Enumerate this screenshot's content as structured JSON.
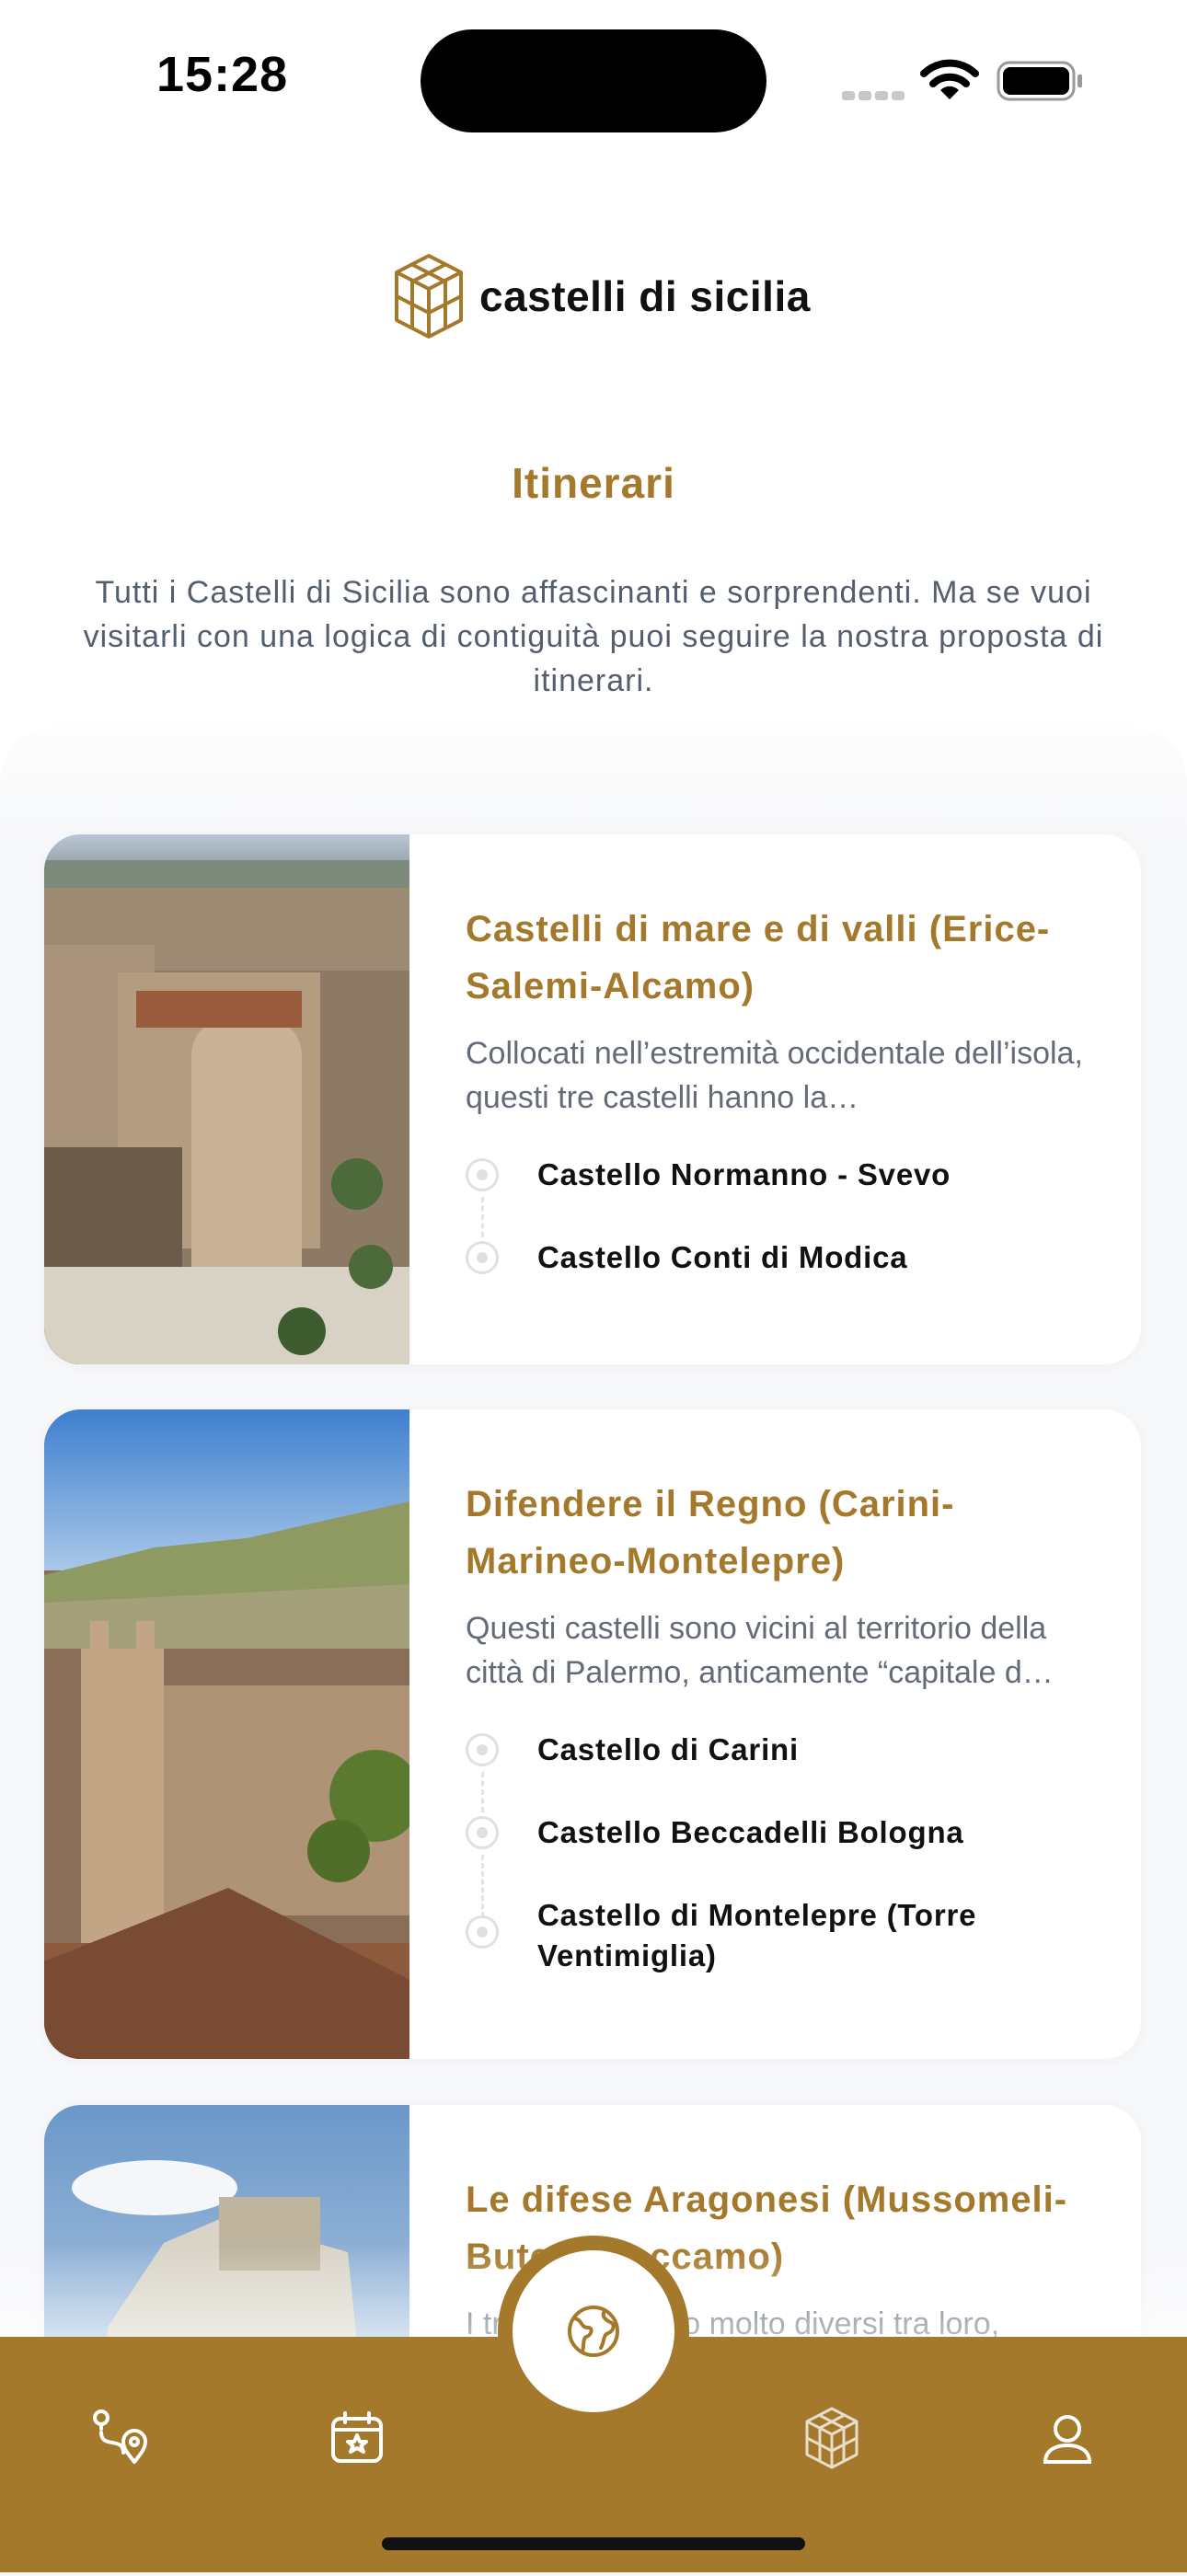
{
  "status_bar": {
    "time": "15:28"
  },
  "brand": {
    "name": "castelli di sicilia",
    "color": "#A5792B"
  },
  "page": {
    "title": "Itinerari",
    "intro": "Tutti i Castelli di Sicilia sono affascinanti e sorprendenti. Ma se vuoi visitarli con una logica di contiguità puoi seguire la nostra proposta di itinerari."
  },
  "itineraries": [
    {
      "title": "Castelli di mare e di valli (Erice-Salemi-Alcamo)",
      "description": "Collocati nell’estremità occidentale dell’isola, questi tre castelli hanno la…",
      "stops": [
        "Castello Normanno - Svevo",
        "Castello Conti di Modica"
      ]
    },
    {
      "title": "Difendere il Regno (Carini-Marineo-Montelepre)",
      "description": "Questi castelli sono vicini al territorio della città di Palermo, anticamente “capitale d…",
      "stops": [
        "Castello di Carini",
        "Castello Beccadelli Bologna",
        "Castello di Montelepre (Torre Ventimiglia)"
      ]
    },
    {
      "title": "Le difese Aragonesi (Mussomeli-Butera-Caccamo) ",
      "description": "I tre castelli sono molto diversi tra loro,",
      "stops": []
    }
  ],
  "tab_bar": {
    "items": [
      {
        "icon": "route-icon"
      },
      {
        "icon": "calendar-star-icon"
      },
      {
        "icon": "globe-icon"
      },
      {
        "icon": "castle-icon"
      },
      {
        "icon": "user-icon"
      }
    ]
  }
}
